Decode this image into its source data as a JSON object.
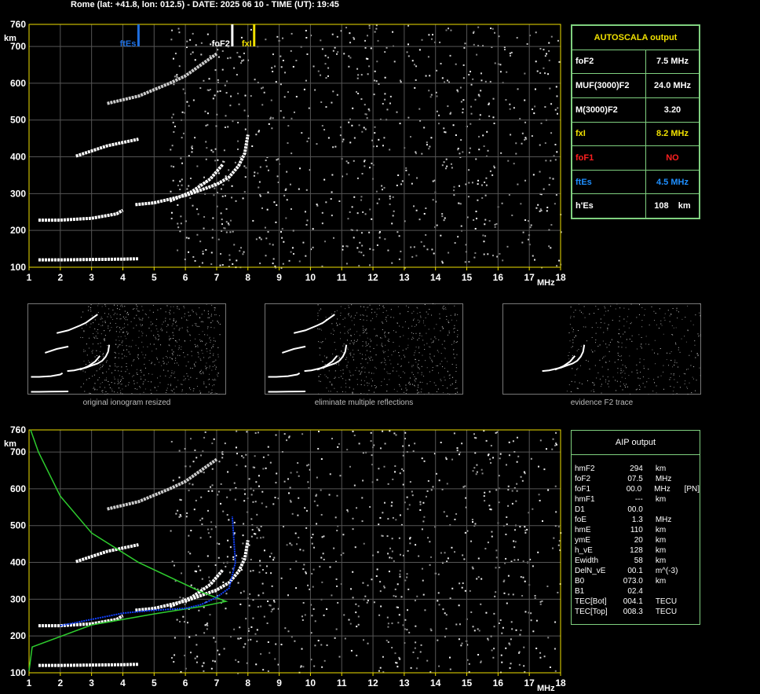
{
  "header": "Rome (lat: +41.8, lon: 012.5) - DATE: 2025 06 10 - TIME (UT): 19:45",
  "axes": {
    "x_ticks": [
      "1",
      "2",
      "3",
      "4",
      "5",
      "6",
      "7",
      "8",
      "9",
      "10",
      "11",
      "12",
      "13",
      "14",
      "15",
      "16",
      "17",
      "18"
    ],
    "x_unit": "MHz",
    "y_ticks": [
      "100",
      "200",
      "300",
      "400",
      "500",
      "600",
      "700",
      "760"
    ],
    "y_unit": "km",
    "xlim": [
      1,
      18
    ],
    "ylim": [
      100,
      760
    ]
  },
  "markers": {
    "ftEs": {
      "label": "ftEs",
      "freq": 4.5,
      "color": "#1e6fe0"
    },
    "foF2": {
      "label": "foF2",
      "freq": 7.5,
      "color": "#ffffff"
    },
    "fxI": {
      "label": "fxI",
      "freq": 8.2,
      "color": "#f0e000"
    }
  },
  "autoscala": {
    "title": "AUTOSCALA output",
    "rows": [
      {
        "name": "foF2",
        "value": "7.5 MHz",
        "color": "#ffffff"
      },
      {
        "name": "MUF(3000)F2",
        "value": "24.0 MHz",
        "color": "#ffffff"
      },
      {
        "name": "M(3000)F2",
        "value": "3.20",
        "color": "#ffffff"
      },
      {
        "name": "fxI",
        "value": "8.2 MHz",
        "color": "#f0e000"
      },
      {
        "name": "foF1",
        "value": "NO",
        "color": "#ff2020"
      },
      {
        "name": "ftEs",
        "value": "4.5 MHz",
        "color": "#1e8fff"
      },
      {
        "name": "h'Es",
        "value": "108    km",
        "color": "#ffffff"
      }
    ]
  },
  "thumbnails": [
    {
      "label": "original ionogram resized"
    },
    {
      "label": "eliminate multiple reflections"
    },
    {
      "label": "evidence F2 trace"
    }
  ],
  "aip": {
    "title": "AIP output",
    "rows": [
      {
        "name": "hmF2",
        "value": "294",
        "unit": "km",
        "extra": ""
      },
      {
        "name": "foF2",
        "value": "07.5",
        "unit": "MHz",
        "extra": ""
      },
      {
        "name": "foF1",
        "value": "00.0",
        "unit": "MHz",
        "extra": "[PN]"
      },
      {
        "name": "hmF1",
        "value": "---",
        "unit": "km",
        "extra": ""
      },
      {
        "name": "D1",
        "value": "00.0",
        "unit": "",
        "extra": ""
      },
      {
        "name": "foE",
        "value": "1.3",
        "unit": "MHz",
        "extra": ""
      },
      {
        "name": "hmE",
        "value": "110",
        "unit": "km",
        "extra": ""
      },
      {
        "name": "ymE",
        "value": "20",
        "unit": "km",
        "extra": ""
      },
      {
        "name": "h_vE",
        "value": "128",
        "unit": "km",
        "extra": ""
      },
      {
        "name": "Ewidth",
        "value": "58",
        "unit": "km",
        "extra": ""
      },
      {
        "name": "DelN_vE",
        "value": "00.1",
        "unit": "m^(-3)",
        "extra": ""
      },
      {
        "name": "B0",
        "value": "073.0",
        "unit": "km",
        "extra": ""
      },
      {
        "name": "B1",
        "value": "02.4",
        "unit": "",
        "extra": ""
      },
      {
        "name": "TEC[Bot]",
        "value": "004.1",
        "unit": "TECU",
        "extra": ""
      },
      {
        "name": "TEC[Top]",
        "value": "008.3",
        "unit": "TECU",
        "extra": ""
      }
    ]
  },
  "chart_data": [
    {
      "type": "scatter",
      "traces": [
        {
          "name": "Es",
          "points": [
            [
              1.3,
              120
            ],
            [
              2,
              120
            ],
            [
              3,
              121
            ],
            [
              4,
              122
            ],
            [
              4.5,
              123
            ]
          ]
        },
        {
          "name": "F2",
          "points": [
            [
              4.4,
              270
            ],
            [
              5,
              275
            ],
            [
              5.5,
              285
            ],
            [
              6,
              295
            ],
            [
              6.5,
              310
            ],
            [
              7,
              325
            ],
            [
              7.4,
              345
            ],
            [
              7.7,
              375
            ],
            [
              7.9,
              410
            ],
            [
              8.0,
              460
            ]
          ]
        },
        {
          "name": "F2x",
          "points": [
            [
              5.5,
              280
            ],
            [
              6.2,
              305
            ],
            [
              6.8,
              340
            ],
            [
              7.2,
              380
            ]
          ]
        },
        {
          "name": "2Es",
          "points": [
            [
              1.3,
              228
            ],
            [
              2,
              228
            ],
            [
              3,
              233
            ],
            [
              3.8,
              245
            ],
            [
              4,
              255
            ]
          ]
        },
        {
          "name": "2F",
          "points": [
            [
              2.5,
              402
            ],
            [
              3.5,
              430
            ],
            [
              4.5,
              448
            ]
          ]
        },
        {
          "name": "3F",
          "points": [
            [
              3.5,
              545
            ],
            [
              4.5,
              565
            ],
            [
              5.5,
              600
            ],
            [
              6,
              620
            ],
            [
              6.5,
              650
            ],
            [
              7,
              680
            ]
          ]
        }
      ]
    },
    {
      "type": "scatter",
      "profile": [
        [
          1.0,
          105
        ],
        [
          1.1,
          170
        ],
        [
          3,
          230
        ],
        [
          5,
          260
        ],
        [
          6.5,
          280
        ],
        [
          7.3,
          294
        ],
        [
          6.5,
          320
        ],
        [
          4.5,
          400
        ],
        [
          3,
          480
        ],
        [
          2,
          580
        ],
        [
          1.3,
          700
        ],
        [
          1.05,
          760
        ]
      ],
      "blue_trace": [
        [
          2,
          228
        ],
        [
          3,
          245
        ],
        [
          4,
          262
        ],
        [
          5,
          270
        ],
        [
          6,
          275
        ],
        [
          6.5,
          285
        ],
        [
          7,
          305
        ],
        [
          7.4,
          330
        ],
        [
          7.6,
          400
        ],
        [
          7.5,
          525
        ]
      ]
    }
  ]
}
